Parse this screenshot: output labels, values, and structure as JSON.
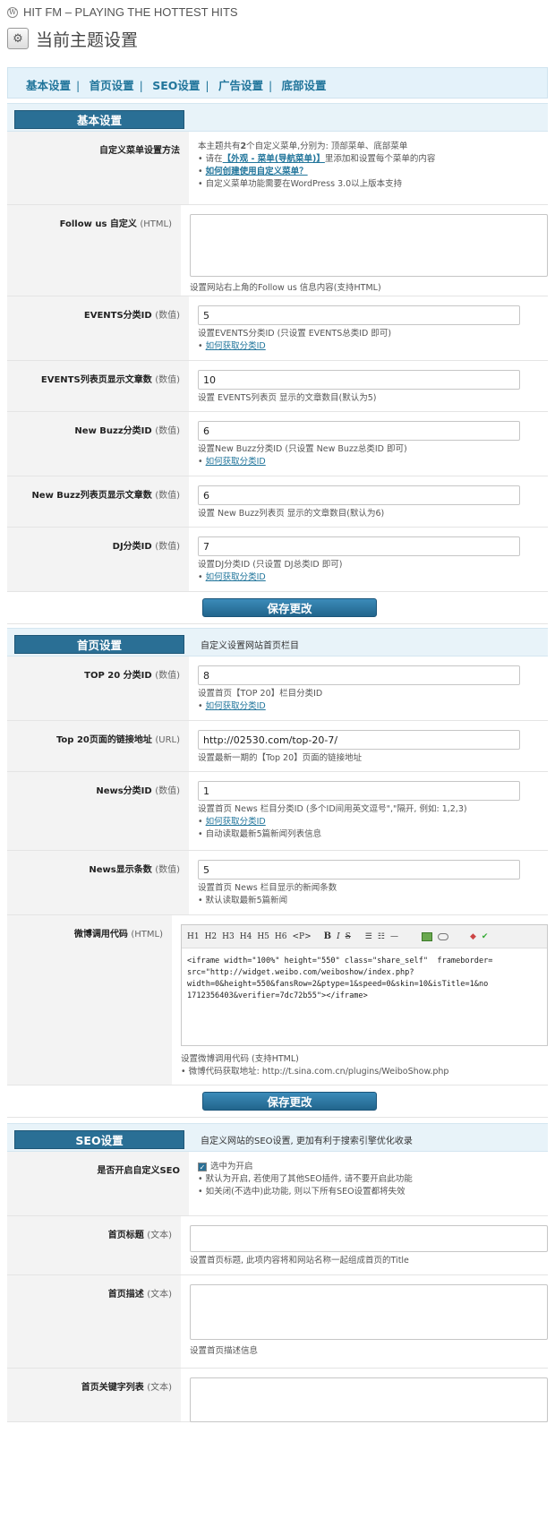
{
  "header": {
    "site_title": "HIT FM – PLAYING THE HOTTEST HITS",
    "page_title": "当前主题设置"
  },
  "nav": {
    "items": [
      "基本设置",
      "首页设置",
      "SEO设置",
      "广告设置",
      "底部设置"
    ]
  },
  "basic": {
    "tab": "基本设置",
    "menu_label": "自定义菜单设置方法",
    "menu_line1_pre": "本主题共有",
    "menu_line1_num": "2",
    "menu_line1_post": "个自定义菜单,分别为: 顶部菜单、底部菜单",
    "menu_line2_pre": "请在",
    "menu_line2_link": "【外观 - 菜单(导航菜单)】",
    "menu_line2_post": "里添加和设置每个菜单的内容",
    "menu_line3_link": "如何创建使用自定义菜单？",
    "menu_line4": "自定义菜单功能需要在WordPress 3.0以上版本支持",
    "follow_label": "Follow us 自定义",
    "follow_type": "(HTML)",
    "follow_hint": "设置网站右上角的Follow us 信息内容(支持HTML)",
    "events_label": "EVENTS分类ID",
    "events_type": "(数值)",
    "events_value": "5",
    "events_hint": "设置EVENTS分类ID (只设置 EVENTS总类ID 即可)",
    "how_id_link": "如何获取分类ID",
    "events_count_label": "EVENTS列表页显示文章数",
    "events_count_type": "(数值)",
    "events_count_value": "10",
    "events_count_hint": "设置 EVENTS列表页 显示的文章数目(默认为5)",
    "buzz_label": "New Buzz分类ID",
    "buzz_type": "(数值)",
    "buzz_value": "6",
    "buzz_hint": "设置New Buzz分类ID (只设置 New Buzz总类ID 即可)",
    "buzz_count_label": "New Buzz列表页显示文章数",
    "buzz_count_type": "(数值)",
    "buzz_count_value": "6",
    "buzz_count_hint": "设置 New Buzz列表页 显示的文章数目(默认为6)",
    "dj_label": "DJ分类ID",
    "dj_type": "(数值)",
    "dj_value": "7",
    "dj_hint": "设置DJ分类ID (只设置 DJ总类ID 即可)",
    "save": "保存更改"
  },
  "home": {
    "tab": "首页设置",
    "desc": "自定义设置网站首页栏目",
    "top20_label": "TOP 20 分类ID",
    "top20_type": "(数值)",
    "top20_value": "8",
    "top20_hint": "设置首页【TOP 20】栏目分类ID",
    "top20url_label": "Top 20页面的链接地址",
    "top20url_type": "(URL)",
    "top20url_value": "http://02530.com/top-20-7/",
    "top20url_hint": "设置最新一期的【Top 20】页面的链接地址",
    "news_label": "News分类ID",
    "news_type": "(数值)",
    "news_value": "1",
    "news_hint": "设置首页 News 栏目分类ID (多个ID间用英文逗号\",\"隔开, 例如: 1,2,3)",
    "news_auto": "自动读取最新5篇新闻列表信息",
    "newscount_label": "News显示条数",
    "newscount_type": "(数值)",
    "newscount_value": "5",
    "newscount_hint": "设置首页 News 栏目显示的新闻条数",
    "newscount_default": "默认读取最新5篇新闻",
    "weibo_label": "微博调用代码",
    "weibo_type": "(HTML)",
    "toolbar": [
      "H1",
      "H2",
      "H3",
      "H4",
      "H5",
      "H6",
      "<P>",
      "B",
      "I",
      "S"
    ],
    "weibo_code": "<iframe width=\"100%\" height=\"550\" class=\"share_self\"  frameborder=\nsrc=\"http://widget.weibo.com/weiboshow/index.php?\nwidth=0&height=550&fansRow=2&ptype=1&speed=0&skin=10&isTitle=1&no\n1712356403&verifier=7dc72b55\"></iframe>",
    "weibo_hint": "设置微博调用代码 (支持HTML)",
    "weibo_addr": "微博代码获取地址: http://t.sina.com.cn/plugins/WeiboShow.php",
    "save": "保存更改"
  },
  "seo": {
    "tab": "SEO设置",
    "desc": "自定义网站的SEO设置, 更加有利于搜索引擎优化收录",
    "enable_label": "是否开启自定义SEO",
    "enable_text": "选中为开启",
    "enable_note1": "默认为开启, 若使用了其他SEO插件, 请不要开启此功能",
    "enable_note2": "如关闭(不选中)此功能, 则以下所有SEO设置都将失效",
    "title_label": "首页标题",
    "title_type": "(文本)",
    "title_hint": "设置首页标题, 此项内容将和网站名称一起组成首页的Title",
    "desc_label": "首页描述",
    "desc_type": "(文本)",
    "desc_hint": "设置首页描述信息",
    "kw_label": "首页关键字列表",
    "kw_type": "(文本)"
  }
}
